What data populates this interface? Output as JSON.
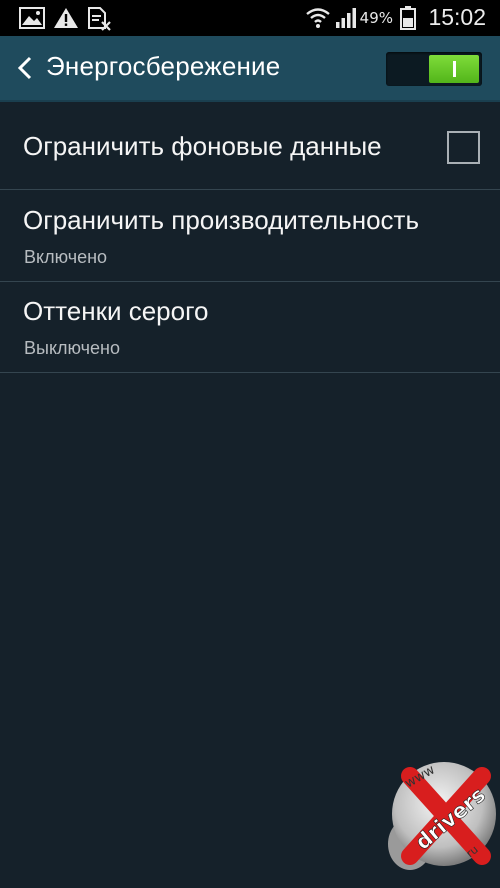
{
  "status_bar": {
    "icons": [
      "gallery-icon",
      "warning-icon",
      "file-blocked-icon"
    ],
    "right_icons": [
      "wifi-icon",
      "signal-icon",
      "battery-icon"
    ],
    "battery_percent": "49%",
    "time": "15:02"
  },
  "header": {
    "title": "Энергосбережение",
    "master_switch_on": true,
    "accent_color": "#6ccb2c",
    "bar_color": "#1f4b5d"
  },
  "settings": [
    {
      "title": "Ограничить фоновые данные",
      "has_checkbox": true,
      "checked": false
    },
    {
      "title": "Ограничить производительность",
      "summary": "Включено"
    },
    {
      "title": "Оттенки серого",
      "summary": "Выключено"
    }
  ],
  "watermark": {
    "line1": "www",
    "line2": "drivers",
    "line3": "ru"
  }
}
